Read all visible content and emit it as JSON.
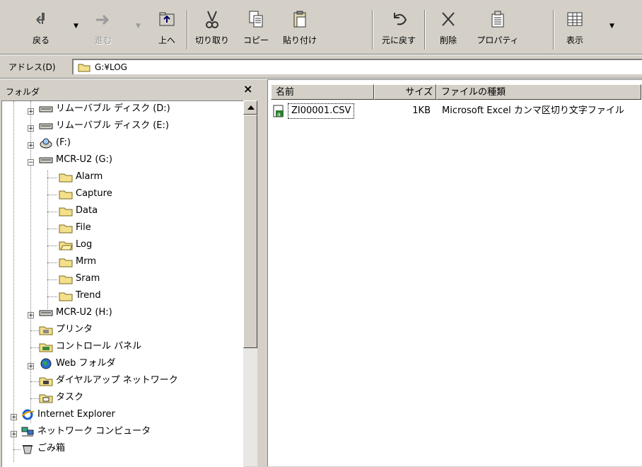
{
  "toolbar": {
    "back_label": "戻る",
    "forward_label": "進む",
    "up_label": "上へ",
    "cut_label": "切り取り",
    "copy_label": "コピー",
    "paste_label": "貼り付け",
    "undo_label": "元に戻す",
    "delete_label": "削除",
    "properties_label": "プロパティ",
    "views_label": "表示"
  },
  "address": {
    "label": "アドレス(D)",
    "value": "G:¥LOG"
  },
  "folder_pane": {
    "title": "フォルダ",
    "close_glyph": "×",
    "items": [
      {
        "label": "リムーバブル ディスク (D:)"
      },
      {
        "label": "リムーバブル ディスク (E:)"
      },
      {
        "label": "(F:)"
      },
      {
        "label": "MCR-U2 (G:)"
      },
      {
        "label": "Alarm"
      },
      {
        "label": "Capture"
      },
      {
        "label": "Data"
      },
      {
        "label": "File"
      },
      {
        "label": "Log"
      },
      {
        "label": "Mrm"
      },
      {
        "label": "Sram"
      },
      {
        "label": "Trend"
      },
      {
        "label": "MCR-U2 (H:)"
      },
      {
        "label": "プリンタ"
      },
      {
        "label": "コントロール パネル"
      },
      {
        "label": "Web フォルダ"
      },
      {
        "label": "ダイヤルアップ ネットワーク"
      },
      {
        "label": "タスク"
      },
      {
        "label": "Internet Explorer"
      },
      {
        "label": "ネットワーク コンピュータ"
      },
      {
        "label": "ごみ箱"
      }
    ]
  },
  "file_list": {
    "columns": [
      "名前",
      "サイズ",
      "ファイルの種類"
    ],
    "rows": [
      {
        "name": "ZI00001.CSV",
        "size": "1KB",
        "type": "Microsoft Excel カンマ区切り文字ファイル"
      }
    ]
  },
  "colors": {
    "chrome": "#d4d0c8",
    "folder_yellow": "#f4e08a",
    "selection_dotted": "#000000"
  }
}
